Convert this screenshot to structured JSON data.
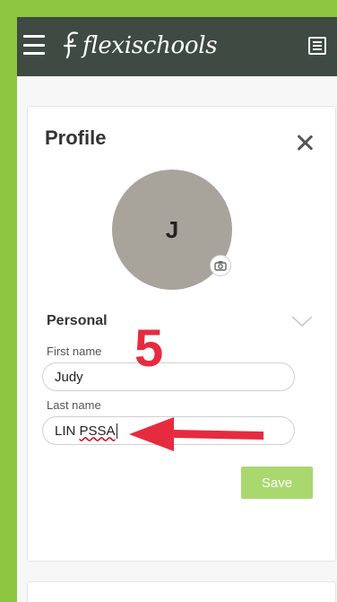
{
  "app": {
    "brand": "flexischools"
  },
  "profile": {
    "title": "Profile",
    "avatar_initial": "J",
    "section_title": "Personal",
    "first_name": {
      "label": "First name",
      "value": "Judy"
    },
    "last_name": {
      "label": "Last name",
      "value_prefix": "LIN ",
      "value_misspelled": "PSSA"
    },
    "save_label": "Save"
  },
  "annotation": {
    "step_number": "5"
  },
  "colors": {
    "frame_green": "#8dc63f",
    "app_bar": "#3f4a42",
    "avatar": "#a8a39b",
    "save_button": "#a9d86e",
    "annotation_red": "#e62b3f"
  },
  "icons": [
    "menu-icon",
    "flexischools-logo-mark",
    "list-icon",
    "close-icon",
    "camera-icon",
    "chevron-down-icon",
    "arrow-left-icon"
  ]
}
